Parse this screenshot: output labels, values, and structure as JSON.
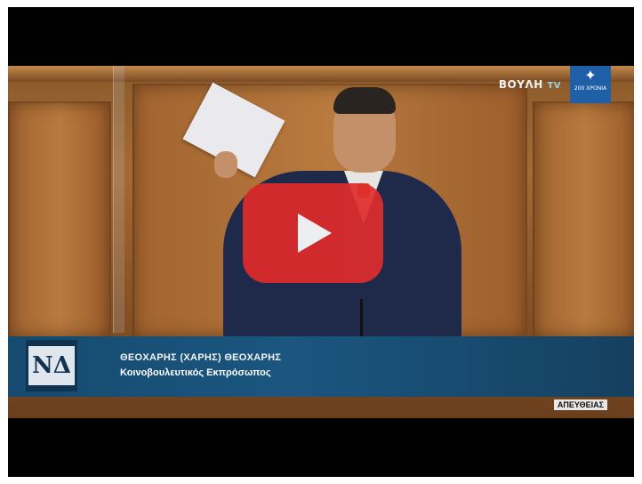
{
  "video": {
    "channel_name": "ΒΟΥΛΗ",
    "channel_suffix": "TV",
    "anniversary_badge": "200 ΧΡΟΝΙΑ",
    "party_logo_text": "ΝΔ",
    "speaker_name": "ΘΕΟΧΑΡΗΣ (ΧΑΡΗΣ) ΘΕΟΧΑΡΗΣ",
    "speaker_role": "Κοινοβουλευτικός Εκπρόσωπος",
    "live_label": "ΑΠΕΥΘΕΙΑΣ"
  },
  "colors": {
    "play_button": "#e02b2b",
    "lower_third": "#1a5680",
    "frame": "#000000"
  },
  "icons": {
    "play": "play-icon"
  }
}
